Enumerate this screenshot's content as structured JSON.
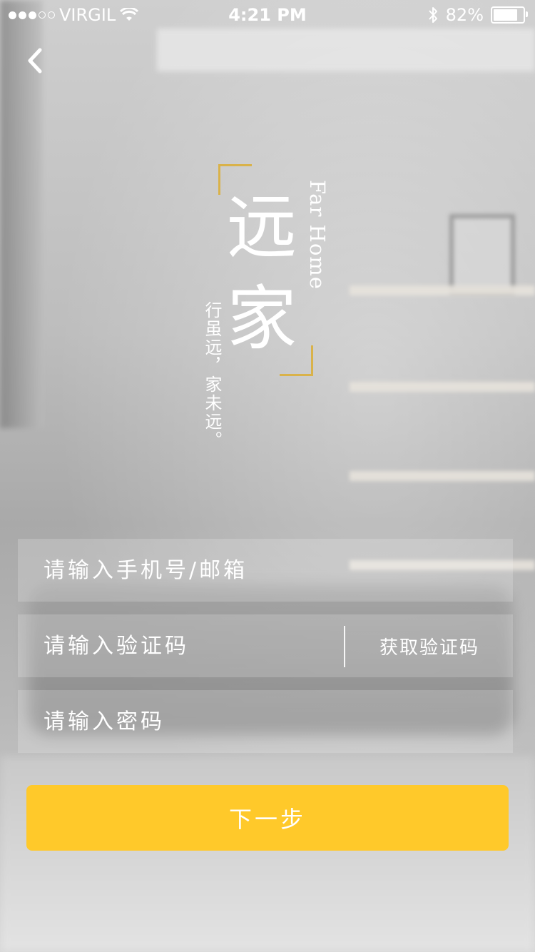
{
  "status_bar": {
    "carrier": "VIRGIL",
    "time": "4:21 PM",
    "battery": "82%",
    "battery_level": 0.82,
    "signal_bars_filled": 3,
    "signal_bars_total": 5
  },
  "nav": {
    "back_icon": "chevron-left-icon"
  },
  "logo": {
    "char1": "远",
    "char2": "家",
    "english": "Far Home",
    "tagline": "行虽远，家未远。",
    "accent_color": "#d9b24a"
  },
  "form": {
    "phone_placeholder": "请输入手机号/邮箱",
    "code_placeholder": "请输入验证码",
    "get_code_label": "获取验证码",
    "password_placeholder": "请输入密码",
    "next_label": "下一步",
    "button_color": "#ffc92a"
  }
}
